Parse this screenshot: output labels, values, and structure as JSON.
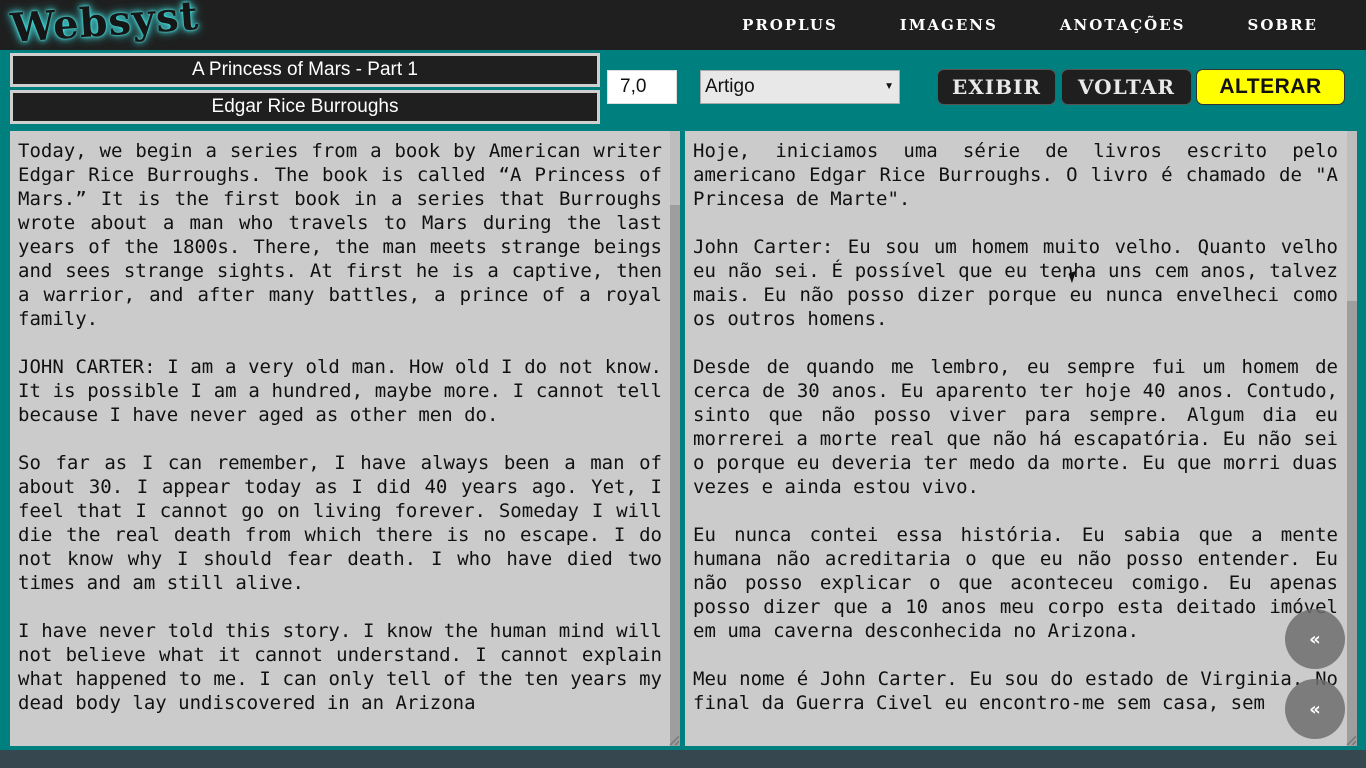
{
  "logo": "Websyst",
  "nav": [
    "PROPLUS",
    "IMAGENS",
    "ANOTAÇÕES",
    "SOBRE"
  ],
  "form": {
    "title": "A Princess of Mars - Part 1",
    "author": "Edgar Rice Burroughs",
    "level": "7,0",
    "type": "Artigo",
    "buttons": {
      "show": "EXIBIR",
      "back": "VOLTAR",
      "edit": "ALTERAR"
    }
  },
  "left_text": [
    "Today, we begin a series from a book by American writer Edgar Rice Burroughs. The book is called “A Princess of Mars.” It is the first book in a series that Burroughs wrote about a man who travels to Mars during the last years of the 1800s. There, the man meets strange beings and sees strange sights. At first he is a captive, then a warrior, and after many battles, a prince of a royal family.",
    "JOHN CARTER: I am a very old man. How old I do not know. It is possible I am a hundred, maybe more. I cannot tell because I have never aged as other men do.",
    "So far as I can remember, I have always been a man of about 30. I appear today as I did 40 years ago. Yet, I feel that I cannot go on living forever. Someday I will die the real death from which there is no escape. I do not know why I should fear death. I who have died two times and am still alive.",
    "I have never told this story. I know the human mind will not believe what it cannot understand. I cannot explain what happened to me. I can only tell of the ten years my dead body lay undiscovered in an Arizona"
  ],
  "right_text": [
    "Hoje, iniciamos uma série de livros escrito pelo americano Edgar Rice Burroughs. O livro é chamado de \"A Princesa de Marte\".",
    "John Carter: Eu sou um homem muito velho. Quanto velho eu não sei. É possível que eu tenha uns cem anos, talvez mais. Eu não posso dizer porque eu nunca envelheci como os outros homens.",
    "Desde de quando me lembro, eu sempre fui um homem de cerca de 30 anos. Eu aparento ter hoje 40 anos. Contudo, sinto que não posso viver para sempre. Algum dia eu morrerei a morte real que não há escapatória. Eu não sei o porque eu deveria ter medo da morte. Eu que morri duas vezes e ainda estou vivo.",
    "Eu nunca contei essa história. Eu sabia que a mente humana não acreditaria o que eu não posso entender. Eu não posso explicar o que aconteceu comigo. Eu apenas posso dizer que a 10 anos meu corpo esta deitado imóvel em uma caverna desconhecida no Arizona.",
    "Meu nome é John Carter. Eu sou do estado de Virginia. No final da Guerra Civel eu encontro-me sem casa, sem"
  ],
  "fab_icon": "«"
}
